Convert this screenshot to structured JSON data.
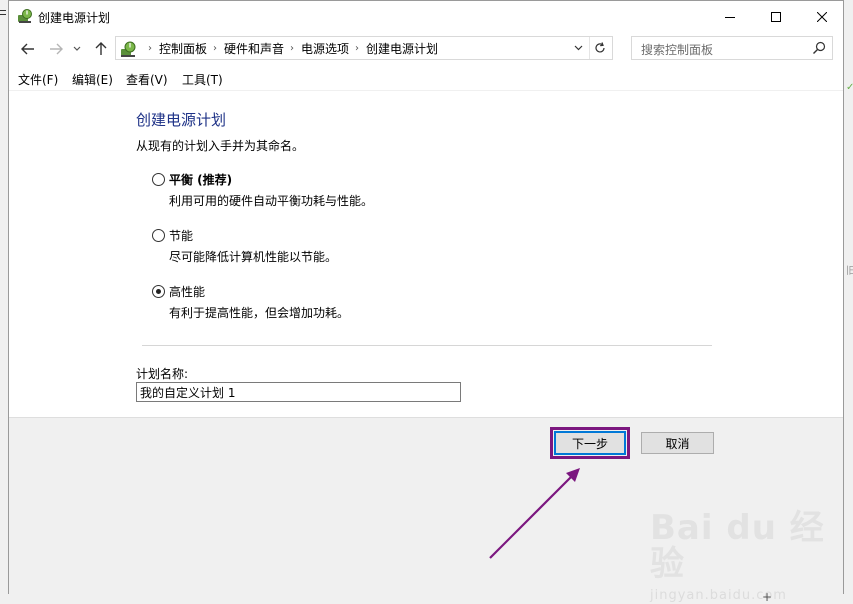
{
  "window": {
    "title": "创建电源计划",
    "controls": {
      "minimize": "minimize",
      "maximize": "maximize",
      "close": "close"
    }
  },
  "nav": {
    "breadcrumbs": [
      "控制面板",
      "硬件和声音",
      "电源选项",
      "创建电源计划"
    ],
    "search_placeholder": "搜索控制面板"
  },
  "menu": [
    "文件(F)",
    "编辑(E)",
    "查看(V)",
    "工具(T)"
  ],
  "main": {
    "heading": "创建电源计划",
    "subtext": "从现有的计划入手并为其命名。",
    "options": [
      {
        "label": "平衡 (推荐)",
        "desc": "利用可用的硬件自动平衡功耗与性能。",
        "selected": false
      },
      {
        "label": "节能",
        "desc": "尽可能降低计算机性能以节能。",
        "selected": false
      },
      {
        "label": "高性能",
        "desc": "有利于提高性能，但会增加功耗。",
        "selected": true
      }
    ],
    "plan_name_label": "计划名称:",
    "plan_name_value": "我的自定义计划 1"
  },
  "buttons": {
    "next": "下一步",
    "cancel": "取消"
  },
  "annotation": {
    "highlight_color": "#7b177f"
  },
  "watermark": {
    "main": "Bai du 经验",
    "sub": "jingyan.baidu.com"
  },
  "colors": {
    "heading": "#1e3287",
    "accent": "#0078d7"
  }
}
